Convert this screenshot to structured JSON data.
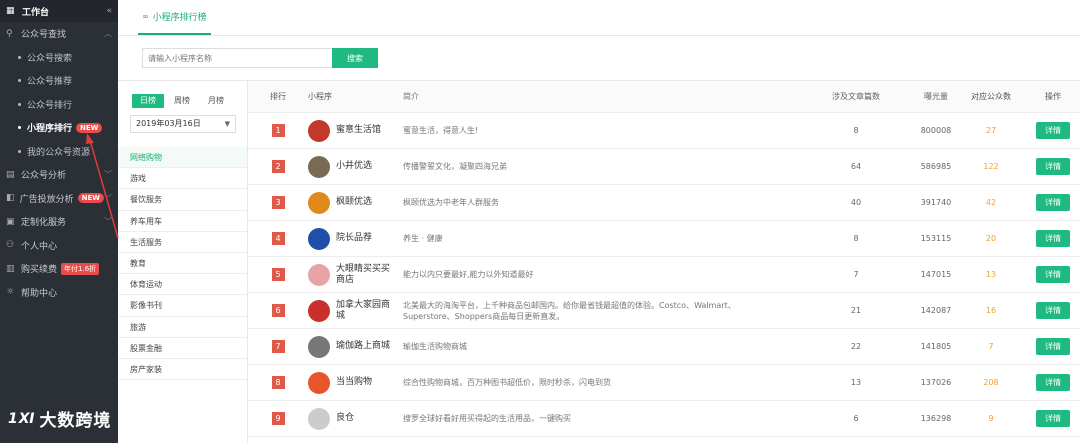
{
  "sidebar": {
    "workbench": "工作台",
    "collapse_icon": "«",
    "groups": [
      {
        "label": "公众号查找",
        "icon": "search-icon",
        "expanded": true
      },
      {
        "label": "公众号分析",
        "icon": "doc-icon"
      },
      {
        "label": "广告投放分析",
        "icon": "ad-icon",
        "badge": "NEW"
      },
      {
        "label": "定制化服务",
        "icon": "custom-icon"
      },
      {
        "label": "个人中心",
        "icon": "user-icon"
      },
      {
        "label": "购买续费",
        "icon": "cart-icon",
        "badge": "年付1.6折"
      },
      {
        "label": "帮助中心",
        "icon": "help-icon"
      }
    ],
    "sub_items": [
      {
        "label": "公众号搜索"
      },
      {
        "label": "公众号推荐"
      },
      {
        "label": "公众号排行"
      },
      {
        "label": "小程序排行",
        "badge": "NEW",
        "active": true
      },
      {
        "label": "我的公众号资源"
      }
    ],
    "watermark": "大数跨境",
    "watermark_mark": "1Ⅺ"
  },
  "tab": {
    "label": "小程序排行榜"
  },
  "search": {
    "placeholder": "请输入小程序名称",
    "button": "搜索"
  },
  "filter": {
    "periods": [
      "日榜",
      "周榜",
      "月榜"
    ],
    "active_period": 0,
    "date": "2019年03月16日",
    "categories": [
      "网络购物",
      "游戏",
      "餐饮服务",
      "养车用车",
      "生活服务",
      "教育",
      "体育运动",
      "影像书刊",
      "旅游",
      "股票金融",
      "房产家装"
    ],
    "active_category": 0
  },
  "table": {
    "headers": {
      "rank": "排行",
      "app": "小程序",
      "desc": "简介",
      "count": "涉及文章篇数",
      "expo": "曝光量",
      "accounts": "对应公众数",
      "op": "操作"
    },
    "detail_label": "详情",
    "rows": [
      {
        "rank": "1",
        "name": "蜜意生活馆",
        "desc": "蜜意生活，得意人生!",
        "count": "8",
        "expo": "800008",
        "accounts": "27",
        "color": "#c0392b"
      },
      {
        "rank": "2",
        "name": "小井优选",
        "desc": "传播警誓文化，凝聚四海兄弟",
        "count": "64",
        "expo": "586985",
        "accounts": "122",
        "color": "#7a6a55"
      },
      {
        "rank": "3",
        "name": "枫颐优选",
        "desc": "枫颐优选为中老年人群服务",
        "count": "40",
        "expo": "391740",
        "accounts": "42",
        "color": "#e08a1e"
      },
      {
        "rank": "4",
        "name": "院长品荐",
        "desc": "养生 · 健康",
        "count": "8",
        "expo": "153115",
        "accounts": "20",
        "color": "#1f4fa8"
      },
      {
        "rank": "5",
        "name": "大眼睛买买买商店",
        "desc": "能力以内只要最好,能力以外知道最好",
        "count": "7",
        "expo": "147015",
        "accounts": "13",
        "color": "#e8a4a4"
      },
      {
        "rank": "6",
        "name": "加拿大家园商城",
        "desc": "北美最大的海淘平台，上千种商品包邮国内。给你最省钱最超值的体验。Costco、Walmart、Superstore、Shoppers商品每日更新直发。",
        "count": "21",
        "expo": "142087",
        "accounts": "16",
        "color": "#c9302c"
      },
      {
        "rank": "7",
        "name": "瑜伽路上商城",
        "desc": "瑜伽生活购物商城",
        "count": "22",
        "expo": "141805",
        "accounts": "7",
        "color": "#777777"
      },
      {
        "rank": "8",
        "name": "当当购物",
        "desc": "综合性购物商城，百万种图书超低价，限时秒杀，闪电到货",
        "count": "13",
        "expo": "137026",
        "accounts": "208",
        "color": "#e8542c"
      },
      {
        "rank": "9",
        "name": "良仓",
        "desc": "搜罗全球好看好用买得起的生活用品，一键购买",
        "count": "6",
        "expo": "136298",
        "accounts": "9",
        "color": "#cccccc"
      }
    ]
  }
}
